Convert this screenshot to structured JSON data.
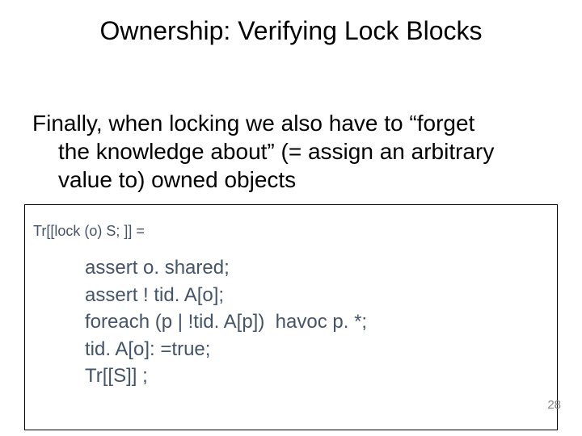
{
  "title": "Ownership: Verifying Lock Blocks",
  "paragraph": {
    "line1": "Finally, when locking we also have to “forget",
    "line2": "the knowledge about” (= assign an arbitrary",
    "line3": "value to) owned objects"
  },
  "code": {
    "header": "Tr[[lock (o) S;  ]] =",
    "lines": [
      "assert o. shared;",
      "assert ! tid. A[o];",
      "foreach (p | !tid. A[p])  havoc p. *;",
      "tid. A[o]: =true;",
      "Tr[[S]] ;"
    ]
  },
  "page_number": "28"
}
